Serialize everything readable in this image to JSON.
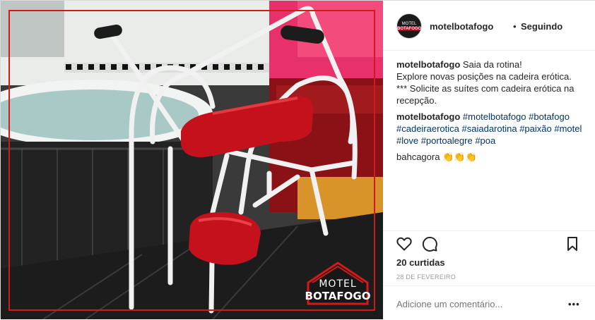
{
  "post": {
    "username": "motelbotafogo",
    "separator": "•",
    "follow_state": "Seguindo",
    "avatar_text": [
      "MOTEL",
      "BOTAFOGO"
    ]
  },
  "photo": {
    "logo_text_top": "MOTEL",
    "logo_text_bottom": "BOTAFOGO",
    "icon": "photo-motel-chair"
  },
  "caption": {
    "username": "motelbotafogo",
    "line1": "Saia da rotina!",
    "line2": "Explore novas posições na cadeira erótica.",
    "line3": "*** Solicite as suítes com cadeira erótica na recepção."
  },
  "hashtag_comment": {
    "username": "motelbotafogo",
    "tags": [
      "#motelbotafogo",
      "#botafogo",
      "#cadeiraerotica",
      "#saiadarotina",
      "#paixão",
      "#motel",
      "#love",
      "#portoalegre",
      "#poa"
    ]
  },
  "third_comment": {
    "username": "bahcagora",
    "text": "👏👏👏"
  },
  "actions": {
    "like_icon": "heart-icon",
    "comment_icon": "comment-icon",
    "save_icon": "bookmark-icon"
  },
  "likes_text": "20 curtidas",
  "date_text": "28 DE FEVEREIRO",
  "add_comment": {
    "placeholder": "Adicione um comentário...",
    "more_label": "•••"
  },
  "colors": {
    "link": "#003569",
    "chair_red": "#c4111c",
    "wall_pink": "#e0285a",
    "frame_red": "#d11b1b"
  }
}
